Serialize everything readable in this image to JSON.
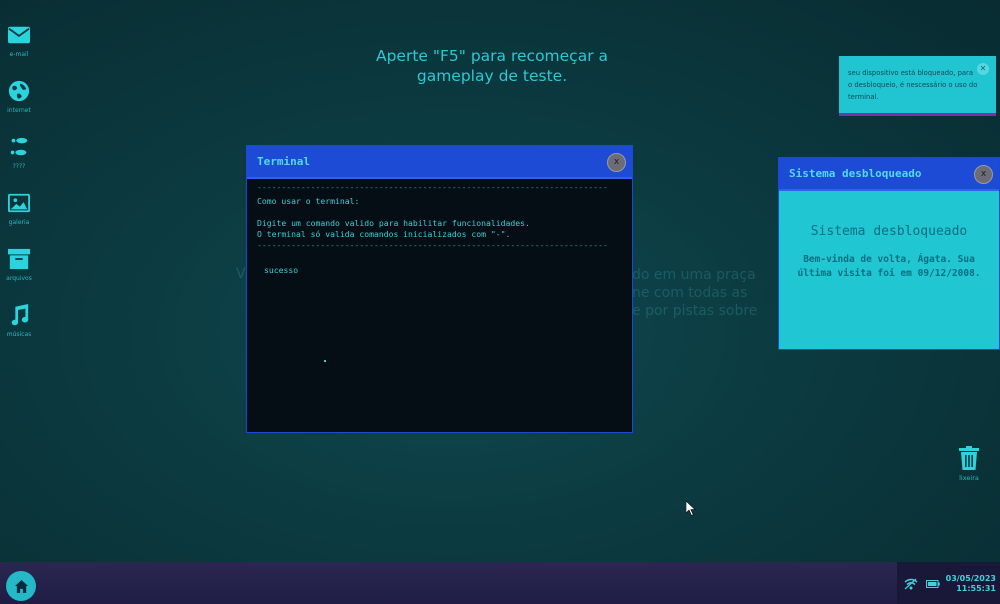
{
  "desktop": {
    "icons": [
      {
        "label": "e-mail",
        "icon": "mail-icon"
      },
      {
        "label": "internet",
        "icon": "globe-icon"
      },
      {
        "label": "????",
        "icon": "footprints-icon"
      },
      {
        "label": "galeria",
        "icon": "image-icon"
      },
      {
        "label": "arquivos",
        "icon": "archive-icon"
      },
      {
        "label": "músicas",
        "icon": "music-note-icon"
      }
    ],
    "trash_label": "lixeira",
    "hint_text": "Aperte \"F5\" para recomeçar a gameplay de teste.",
    "background_letter": "V",
    "background_story": [
      "do em uma praça",
      "ne com todas as",
      "e por pistas sobre"
    ]
  },
  "notification": {
    "text": "seu dispositivo está bloqueado, para o desbloqueio, é nescessário o uso do terminal.",
    "close_glyph": "✕"
  },
  "terminal": {
    "title": "Terminal",
    "close_glyph": "x",
    "divider": "------------------------------------------------------------------------",
    "heading": "Como usar o terminal:",
    "instructions": [
      "Digite um comando valido para habilitar funcionalidades.",
      "O terminal só valida comandos inicializados com \"-\"."
    ],
    "output": "sucesso"
  },
  "unlock_window": {
    "title": "Sistema desbloqueado",
    "close_glyph": "x",
    "heading": "Sistema desbloqueado",
    "message": "Bem-vinda de volta, Ágata. Sua última visita foi em 09/12/2008."
  },
  "taskbar": {
    "date": "03/05/2023",
    "time": "11:55:31"
  },
  "colors": {
    "accent": "#23b9c6",
    "window_titlebar": "#1e4bd6",
    "taskbar": "#221f4a"
  }
}
